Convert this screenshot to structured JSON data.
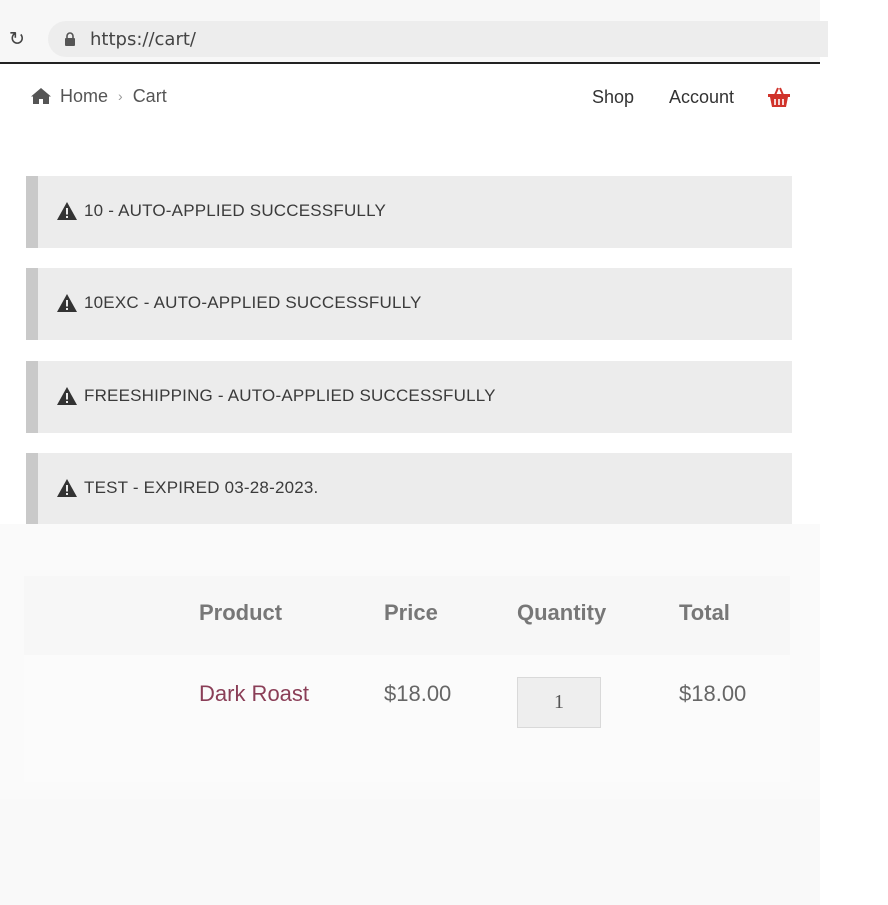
{
  "browser": {
    "reload_icon": "reload-icon",
    "url": "https://cart/"
  },
  "breadcrumb": {
    "home_icon": "home-icon",
    "home": "Home",
    "separator": "›",
    "current": "Cart"
  },
  "nav": {
    "shop": "Shop",
    "account": "Account",
    "basket_icon": "basket-icon",
    "basket_color": "#d0332b"
  },
  "notices": [
    {
      "icon": "warning-icon",
      "text": "10 - AUTO-APPLIED SUCCESSFULLY"
    },
    {
      "icon": "warning-icon",
      "text": "10EXC - AUTO-APPLIED SUCCESSFULLY"
    },
    {
      "icon": "warning-icon",
      "text": "FREESHIPPING - AUTO-APPLIED SUCCESSFULLY"
    },
    {
      "icon": "warning-icon",
      "text": "TEST - EXPIRED 03-28-2023."
    }
  ],
  "cart": {
    "headers": {
      "product": "Product",
      "price": "Price",
      "quantity": "Quantity",
      "total": "Total"
    },
    "rows": [
      {
        "product": "Dark Roast",
        "price": "$18.00",
        "quantity": "1",
        "total": "$18.00"
      }
    ]
  },
  "colors": {
    "notice_bg": "#ececec",
    "notice_border": "#c9c9c9",
    "product_link": "#8a3e57"
  }
}
